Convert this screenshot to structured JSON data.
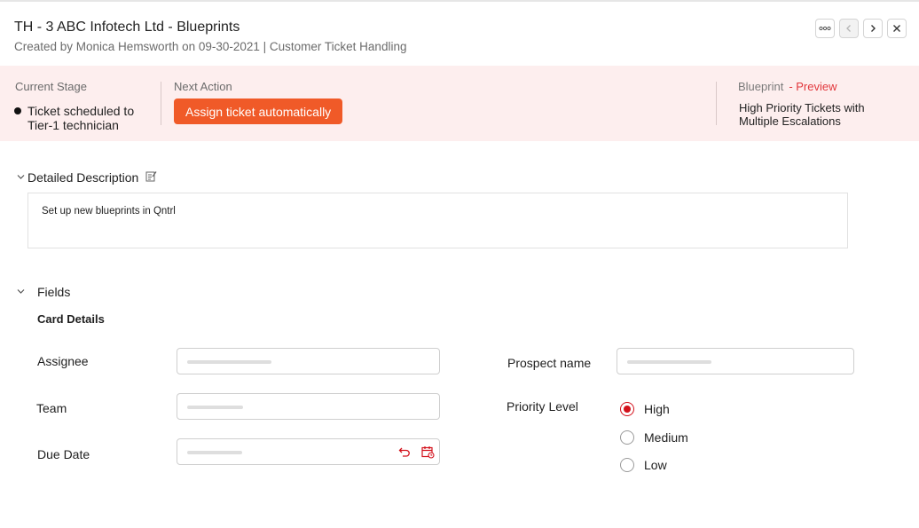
{
  "header": {
    "title": "TH - 3 ABC Infotech Ltd -  Blueprints",
    "subtitle": "Created by Monica Hemsworth on 09-30-2021 | Customer Ticket Handling"
  },
  "nav": {
    "icons": [
      "more-icon",
      "chevron-left-icon",
      "chevron-right-icon",
      "close-icon"
    ]
  },
  "blueprint_bar": {
    "current_stage_label": "Current Stage",
    "current_stage_value": "Ticket scheduled to Tier-1 technician",
    "next_action_label": "Next Action",
    "next_action_button": "Assign ticket automatically",
    "blueprint_label": "Blueprint",
    "blueprint_preview": "- Preview",
    "blueprint_value": "High Priority Tickets with Multiple Escalations"
  },
  "description": {
    "title": "Detailed Description",
    "text": "Set up new blueprints in Qntrl"
  },
  "fields": {
    "title": "Fields",
    "card_details": "Card Details",
    "assignee_label": "Assignee",
    "team_label": "Team",
    "due_date_label": "Due Date",
    "prospect_label": "Prospect name",
    "priority_label": "Priority Level",
    "priority_options": [
      {
        "label": "High",
        "selected": true
      },
      {
        "label": "Medium",
        "selected": false
      },
      {
        "label": "Low",
        "selected": false
      }
    ]
  },
  "colors": {
    "accent": "#f05a28",
    "band": "#fdeeee",
    "preview": "#e2373c",
    "radio_selected": "#d3111b"
  }
}
